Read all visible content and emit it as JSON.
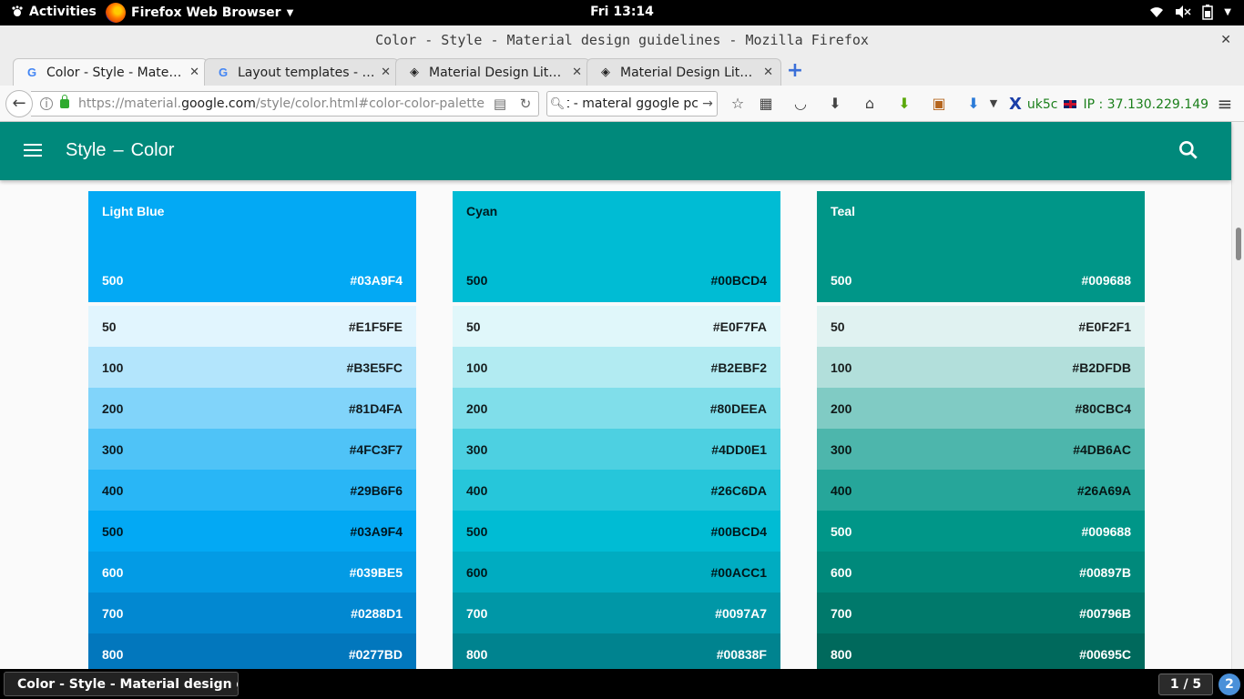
{
  "system": {
    "activities": "Activities",
    "app_name": "Firefox Web Browser",
    "clock": "Fri 13:14"
  },
  "window": {
    "title": "Color - Style - Material design guidelines - Mozilla Firefox"
  },
  "tabs": [
    {
      "label": "Color - Style - Material design guidelines",
      "icon": "google-icon",
      "active": true
    },
    {
      "label": "Layout templates - Responsive",
      "icon": "google-icon",
      "active": false
    },
    {
      "label": "Material Design Lite Components",
      "icon": "mdl-icon",
      "active": false
    },
    {
      "label": "Material Design Lite Templates",
      "icon": "mdl-icon",
      "active": false
    }
  ],
  "navbar": {
    "url_prefix": "https://material.",
    "url_host": "google.com",
    "url_path": "/style/color.html#color-color-palette",
    "search_value": "oint - materal ggogle pc",
    "vpn_label": "uk5c",
    "ip_label": "IP : 37.130.229.149"
  },
  "site": {
    "section": "Style",
    "separator": "–",
    "page": "Color"
  },
  "palettes": [
    {
      "name": "Light Blue",
      "header_shade": "500",
      "header_hex": "#03A9F4",
      "header_color": "#03A9F4",
      "shades": [
        {
          "shade": "50",
          "hex": "#E1F5FE",
          "color": "#E1F5FE",
          "text": "light"
        },
        {
          "shade": "100",
          "hex": "#B3E5FC",
          "color": "#B3E5FC",
          "text": "light"
        },
        {
          "shade": "200",
          "hex": "#81D4FA",
          "color": "#81D4FA",
          "text": "light"
        },
        {
          "shade": "300",
          "hex": "#4FC3F7",
          "color": "#4FC3F7",
          "text": "light"
        },
        {
          "shade": "400",
          "hex": "#29B6F6",
          "color": "#29B6F6",
          "text": "light"
        },
        {
          "shade": "500",
          "hex": "#03A9F4",
          "color": "#03A9F4",
          "text": "light"
        },
        {
          "shade": "600",
          "hex": "#039BE5",
          "color": "#039BE5",
          "text": "dark"
        },
        {
          "shade": "700",
          "hex": "#0288D1",
          "color": "#0288D1",
          "text": "dark"
        },
        {
          "shade": "800",
          "hex": "#0277BD",
          "color": "#0277BD",
          "text": "dark"
        }
      ]
    },
    {
      "name": "Cyan",
      "header_shade": "500",
      "header_hex": "#00BCD4",
      "header_color": "#00BCD4",
      "shades": [
        {
          "shade": "50",
          "hex": "#E0F7FA",
          "color": "#E0F7FA",
          "text": "light"
        },
        {
          "shade": "100",
          "hex": "#B2EBF2",
          "color": "#B2EBF2",
          "text": "light"
        },
        {
          "shade": "200",
          "hex": "#80DEEA",
          "color": "#80DEEA",
          "text": "light"
        },
        {
          "shade": "300",
          "hex": "#4DD0E1",
          "color": "#4DD0E1",
          "text": "light"
        },
        {
          "shade": "400",
          "hex": "#26C6DA",
          "color": "#26C6DA",
          "text": "light"
        },
        {
          "shade": "500",
          "hex": "#00BCD4",
          "color": "#00BCD4",
          "text": "light"
        },
        {
          "shade": "600",
          "hex": "#00ACC1",
          "color": "#00ACC1",
          "text": "light"
        },
        {
          "shade": "700",
          "hex": "#0097A7",
          "color": "#0097A7",
          "text": "dark"
        },
        {
          "shade": "800",
          "hex": "#00838F",
          "color": "#00838F",
          "text": "dark"
        }
      ]
    },
    {
      "name": "Teal",
      "header_shade": "500",
      "header_hex": "#009688",
      "header_color": "#009688",
      "shades": [
        {
          "shade": "50",
          "hex": "#E0F2F1",
          "color": "#E0F2F1",
          "text": "light"
        },
        {
          "shade": "100",
          "hex": "#B2DFDB",
          "color": "#B2DFDB",
          "text": "light"
        },
        {
          "shade": "200",
          "hex": "#80CBC4",
          "color": "#80CBC4",
          "text": "light"
        },
        {
          "shade": "300",
          "hex": "#4DB6AC",
          "color": "#4DB6AC",
          "text": "light"
        },
        {
          "shade": "400",
          "hex": "#26A69A",
          "color": "#26A69A",
          "text": "light"
        },
        {
          "shade": "500",
          "hex": "#009688",
          "color": "#009688",
          "text": "dark"
        },
        {
          "shade": "600",
          "hex": "#00897B",
          "color": "#00897B",
          "text": "dark"
        },
        {
          "shade": "700",
          "hex": "#00796B",
          "color": "#00796B",
          "text": "dark"
        },
        {
          "shade": "800",
          "hex": "#00695C",
          "color": "#00695C",
          "text": "dark"
        }
      ]
    }
  ],
  "taskbar": {
    "task_label": "Color - Style - Material design gu...",
    "workspace": "1 / 5",
    "notifications": "2"
  },
  "colors": {
    "appbar": "#00897B",
    "palette_header_text_light_blue": "dark",
    "palette_header_text_cyan": "light",
    "palette_header_text_teal": "dark"
  }
}
